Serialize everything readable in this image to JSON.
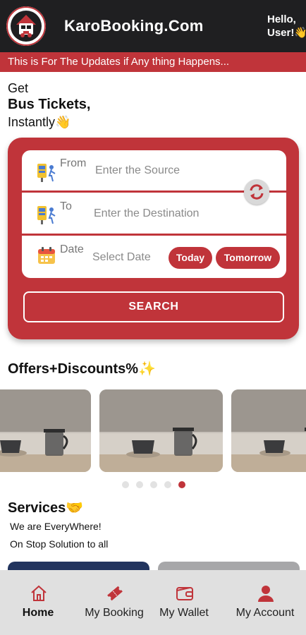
{
  "header": {
    "title": "KaroBooking.Com",
    "greeting_line1": "Hello,",
    "greeting_line2": "User!",
    "greeting_emoji": "👋"
  },
  "ticker": {
    "text": "This is For The Updates if Any thing Happens..."
  },
  "intro": {
    "line1": "Get",
    "line2": "Bus Tickets,",
    "line3": "Instantly",
    "emoji": "👋"
  },
  "search_form": {
    "from_label": "From",
    "from_placeholder": "Enter the Source",
    "to_label": "To",
    "to_placeholder": "Enter the Destination",
    "date_label": "Date",
    "date_placeholder": "Select Date",
    "today_label": "Today",
    "tomorrow_label": "Tomorrow",
    "search_label": "SEARCH",
    "icons": [
      "bus-stop-icon",
      "bus-stop-icon",
      "calendar-icon",
      "swap-icon"
    ]
  },
  "offers": {
    "title": "Offers+Discounts%",
    "emoji": "✨",
    "slides": 3,
    "dots_total": 5,
    "active_dot": 5
  },
  "services": {
    "title": "Services",
    "emoji": "🤝",
    "line1": "We are EveryWhere!",
    "line2": "On Stop Solution to all"
  },
  "bottom_nav": [
    {
      "label": "Home",
      "icon": "home-icon",
      "active": true
    },
    {
      "label": "My Booking",
      "icon": "ticket-icon",
      "active": false
    },
    {
      "label": "My Wallet",
      "icon": "wallet-icon",
      "active": false
    },
    {
      "label": "My Account",
      "icon": "account-icon",
      "active": false
    }
  ],
  "colors": {
    "brand_red": "#c0343a",
    "header_dark": "#1f1f21",
    "nav_bg": "#e0e0e0"
  }
}
